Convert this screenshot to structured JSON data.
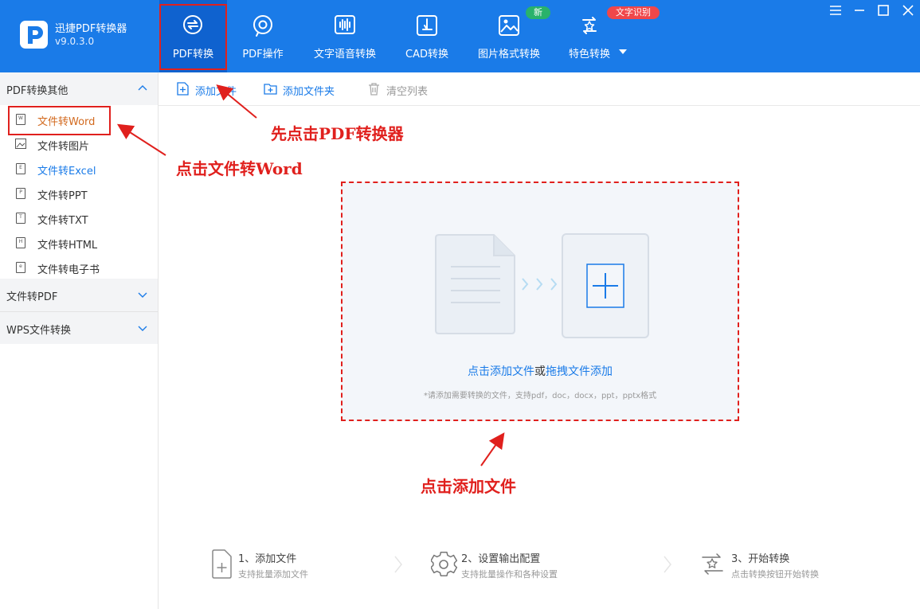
{
  "app": {
    "name": "迅捷PDF转换器",
    "version": "v9.0.3.0"
  },
  "nav": {
    "tabs": [
      {
        "label": "PDF转换",
        "icon": "pdf-convert-icon",
        "active": true
      },
      {
        "label": "PDF操作",
        "icon": "pdf-operate-icon"
      },
      {
        "label": "文字语音转换",
        "icon": "voice-wave-icon"
      },
      {
        "label": "CAD转换",
        "icon": "cad-icon"
      },
      {
        "label": "图片格式转换",
        "icon": "image-icon",
        "badge": "新"
      },
      {
        "label": "特色转换",
        "icon": "special-convert-icon",
        "badge": "文字识别"
      }
    ],
    "badge_colors": {
      "new": "#29b26b",
      "ocr": "#f0474a"
    }
  },
  "window_controls": [
    "menu-icon",
    "minimize-icon",
    "maximize-icon",
    "close-icon"
  ],
  "sidebar": {
    "section1": "PDF转换其他",
    "items": [
      {
        "label": "文件转Word",
        "icon": "word-file-icon",
        "glyph": "W"
      },
      {
        "label": "文件转图片",
        "icon": "image-file-icon",
        "glyph": ""
      },
      {
        "label": "文件转Excel",
        "icon": "excel-file-icon",
        "glyph": "E"
      },
      {
        "label": "文件转PPT",
        "icon": "ppt-file-icon",
        "glyph": "P"
      },
      {
        "label": "文件转TXT",
        "icon": "txt-file-icon",
        "glyph": "T"
      },
      {
        "label": "文件转HTML",
        "icon": "html-file-icon",
        "glyph": "H"
      },
      {
        "label": "文件转电子书",
        "icon": "ebook-file-icon",
        "glyph": "e"
      }
    ],
    "section2": "文件转PDF",
    "section3": "WPS文件转换"
  },
  "toolbar": {
    "add_file": "添加文件",
    "add_folder": "添加文件夹",
    "clear_list": "清空列表"
  },
  "dropzone": {
    "link1": "点击添加文件",
    "or": "或",
    "link2": "拖拽文件添加",
    "hint": "*请添加需要转换的文件，支持pdf，doc，docx，ppt，pptx格式"
  },
  "annotations": {
    "first": "先点击PDF转换器",
    "word": "点击文件转Word",
    "add": "点击添加文件"
  },
  "steps": [
    {
      "title": "1、添加文件",
      "sub": "支持批量添加文件",
      "icon": "add-file-icon"
    },
    {
      "title": "2、设置输出配置",
      "sub": "支持批量操作和各种设置",
      "icon": "settings-gear-icon"
    },
    {
      "title": "3、开始转换",
      "sub": "点击转换按钮开始转换",
      "icon": "start-convert-icon"
    }
  ],
  "colors": {
    "accent": "#1a7be8",
    "annotation": "#e0201d",
    "selected_text": "#d2691e"
  }
}
